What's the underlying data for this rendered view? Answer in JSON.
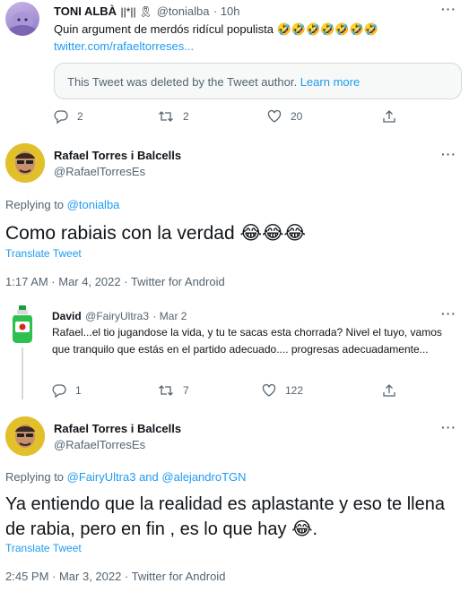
{
  "tweet1": {
    "name": "TONI ALBÀ",
    "name_suffix": "||*|| 🎗",
    "handle": "@tonialba",
    "time": "· 10h",
    "text": "Quin argument de merdós ridícul populista 🤣🤣🤣🤣🤣🤣🤣",
    "link": "twitter.com/rafaeltorreses...",
    "quoted_deleted": "This Tweet was deleted by the Tweet author.",
    "learn_more": "Learn more",
    "replies": "2",
    "retweets": "2",
    "likes": "20"
  },
  "tweet2": {
    "name": "Rafael Torres i Balcells",
    "handle": "@RafaelTorresEs",
    "replying_prefix": "Replying to",
    "replying_to": "@tonialba",
    "text": "Como rabiais con la verdad 😂😂😂",
    "translate": "Translate Tweet",
    "meta": "1:17 AM · Mar 4, 2022 · Twitter for Android"
  },
  "tweet3": {
    "name": "David",
    "handle": "@FairyUltra3",
    "time": "· Mar 2",
    "text": "Rafael...el tio jugandose la vida, y tu te sacas esta chorrada? Nivel el tuyo, vamos que tranquilo que estás en el partido adecuado.... progresas adecuadamente...",
    "replies": "1",
    "retweets": "7",
    "likes": "122"
  },
  "tweet4": {
    "name": "Rafael Torres i Balcells",
    "handle": "@RafaelTorresEs",
    "replying_prefix": "Replying to",
    "replying_to_1": "@FairyUltra3",
    "replying_and": "and",
    "replying_to_2": "@alejandroTGN",
    "text": "Ya entiendo que la realidad es aplastante y eso te llena de rabia, pero en fin , es lo que hay 😂.",
    "translate": "Translate Tweet",
    "meta": "2:45 PM · Mar 3, 2022 · Twitter for Android"
  },
  "more_label": "···",
  "colors": {
    "accent": "#1d9bf0",
    "muted": "#536471",
    "text": "#0f1419",
    "border": "#cfd9de"
  }
}
